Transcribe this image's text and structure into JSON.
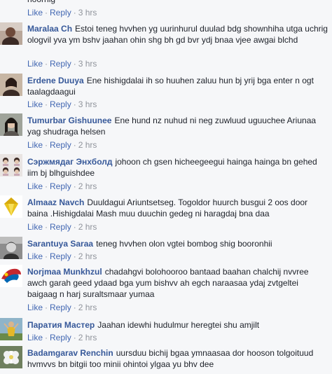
{
  "top_fragment": {
    "text_tail": "hoorhig",
    "like_label": "Like",
    "reply_label": "Reply",
    "time": "3 hrs"
  },
  "comments": [
    {
      "author": "Maralaa Ch",
      "text": "Estoi teneg hvvhen yg uurinhurul duulad bdg shownhiha utga uchrig ologvil yva ym bshv jaahan ohin shg bh gd bvr ydj bnaa vjee awgai blchd",
      "like_label": "Like",
      "reply_label": "Reply",
      "time": "3 hrs",
      "avatar_icon": "person-photo-icon"
    },
    {
      "author": "Erdene Duuya",
      "text": "Ene hishigdalai ih so huuhen zaluu hun bj yrij bga enter n ogt taalagdaagui",
      "like_label": "Like",
      "reply_label": "Reply",
      "time": "3 hrs",
      "avatar_icon": "person-photo-icon"
    },
    {
      "author": "Tumurbar Gishuunee",
      "text": "Ene hund nz nuhud ni neg zuwluud uguuchee Ariunaa yag shudraga helsen",
      "like_label": "Like",
      "reply_label": "Reply",
      "time": "2 hrs",
      "avatar_icon": "person-photo-icon"
    },
    {
      "author": "Сэржмядаг Энхболд",
      "text": "johoon ch gsen hicheegeegui hainga hainga bn gehed iim bj blhguishdee",
      "like_label": "Like",
      "reply_label": "Reply",
      "time": "2 hrs",
      "avatar_icon": "group-photo-icon"
    },
    {
      "author": "Almaaz Navch",
      "text": "Duuldagui Ariuntsetseg. Togoldor huurch busgui 2 oos door baina .Hishigdalai Mash muu duuchin gedeg ni haragdaj bna daa",
      "like_label": "Like",
      "reply_label": "Reply",
      "time": "2 hrs",
      "avatar_icon": "diamond-icon"
    },
    {
      "author": "Sarantuya Saraa",
      "text": "teneg hvvhen olon vgtei bombog shig booronhii",
      "like_label": "Like",
      "reply_label": "Reply",
      "time": "2 hrs",
      "avatar_icon": "person-photo-icon"
    },
    {
      "author": "Norjmaa Munkhzul",
      "text": "chadahgvi bolohooroo bantaad baahan chalchij nvvree awch garah geed ydaad bga yum bishvv ah egch naraasaa ydaj zvtgeltei baigaag n harj suraltsmaar yumaa",
      "like_label": "Like",
      "reply_label": "Reply",
      "time": "2 hrs",
      "avatar_icon": "flag-photo-icon"
    },
    {
      "author": "Паратия Мастер",
      "text": "Jaahan idewhi hudulmur heregtei shu amjilt",
      "like_label": "Like",
      "reply_label": "Reply",
      "time": "2 hrs",
      "avatar_icon": "person-photo-icon"
    },
    {
      "author": "Badamgarav Renchin",
      "text": "uursduu bichij bgaa ymnaasaa dor hooson tolgoituud hvmvvs bn bitgii too minii ohintoi ylgaa yu bhv dee",
      "like_label": "Like",
      "reply_label": "Reply",
      "time": "",
      "avatar_icon": "flower-photo-icon"
    }
  ]
}
